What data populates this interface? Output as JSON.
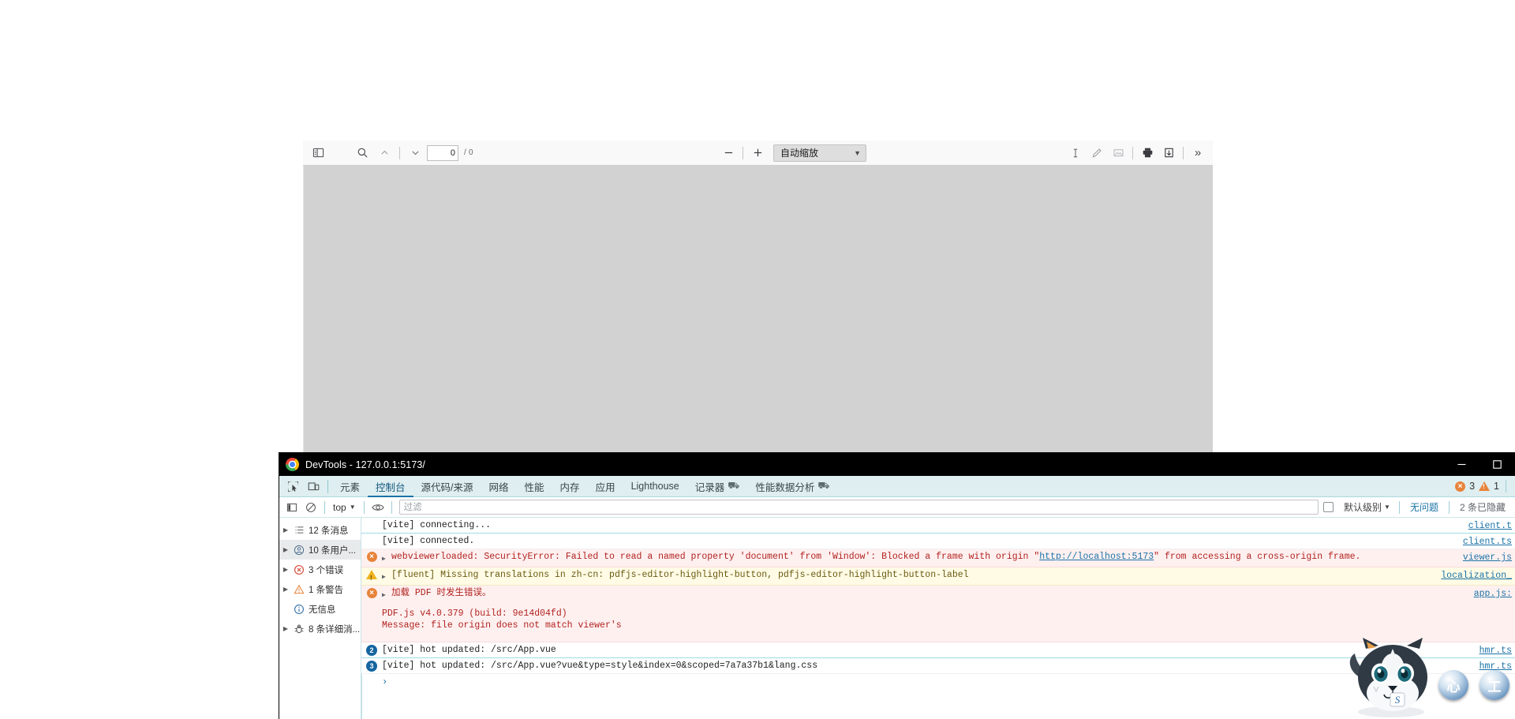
{
  "pdf_viewer": {
    "sidebar_toggle": "sidebar-toggle",
    "find_label": "find",
    "page_value": "0",
    "page_total": "/ 0",
    "zoom_out": "−",
    "zoom_in": "+",
    "zoom_level": "自动缩放",
    "tools": [
      "text-select-tool",
      "draw-tool",
      "image-tool",
      "print-tool",
      "save-tool",
      "more-tools"
    ],
    "more_label": "»"
  },
  "devtools": {
    "window_title": "DevTools - 127.0.0.1:5173/",
    "window_controls": {
      "minimize": "—",
      "maximize": "☐"
    },
    "tabs": [
      {
        "label": "元素",
        "active": false,
        "flask": false
      },
      {
        "label": "控制台",
        "active": true,
        "flask": false
      },
      {
        "label": "源代码/来源",
        "active": false,
        "flask": false
      },
      {
        "label": "网络",
        "active": false,
        "flask": false
      },
      {
        "label": "性能",
        "active": false,
        "flask": false
      },
      {
        "label": "内存",
        "active": false,
        "flask": false
      },
      {
        "label": "应用",
        "active": false,
        "flask": false
      },
      {
        "label": "Lighthouse",
        "active": false,
        "flask": false
      },
      {
        "label": "记录器",
        "active": false,
        "flask": true
      },
      {
        "label": "性能数据分析",
        "active": false,
        "flask": true
      }
    ],
    "status": {
      "error_count": "3",
      "warning_count": "1"
    },
    "filterbar": {
      "context": "top",
      "filter_placeholder": "过滤",
      "level": "默认级别",
      "issues": "无问题",
      "hidden": "2 条已隐藏"
    },
    "sidebar": [
      {
        "label": "12 条消息",
        "icon": "list-icon",
        "arrow": true,
        "selected": false
      },
      {
        "label": "10 条用户...",
        "icon": "user-icon",
        "arrow": true,
        "selected": true
      },
      {
        "label": "3 个错误",
        "icon": "error-icon",
        "arrow": true,
        "selected": false
      },
      {
        "label": "1 条警告",
        "icon": "warning-icon",
        "arrow": true,
        "selected": false
      },
      {
        "label": "无信息",
        "icon": "info-icon",
        "arrow": false,
        "selected": false
      },
      {
        "label": "8 条详细消...",
        "icon": "bug-icon",
        "arrow": true,
        "selected": false
      }
    ],
    "logs": [
      {
        "kind": "plain",
        "icon": "none",
        "expandable": false,
        "text": "[vite] connecting...",
        "source": "client.t",
        "separator": "info"
      },
      {
        "kind": "plain",
        "icon": "none",
        "expandable": false,
        "text": "[vite] connected.",
        "source": "client.ts"
      },
      {
        "kind": "err",
        "icon": "error",
        "expandable": true,
        "text_pre": "webviewerloaded: SecurityError: Failed to read a named property 'document' from 'Window': Blocked a frame with origin \"",
        "link": "http://localhost:5173",
        "text_post": "\" from accessing a cross-origin frame.",
        "source": "viewer.js"
      },
      {
        "kind": "warn",
        "icon": "warn",
        "expandable": true,
        "text": "[fluent] Missing translations in zh-cn: pdfjs-editor-highlight-button, pdfjs-editor-highlight-button-label",
        "source": "localization_"
      },
      {
        "kind": "err",
        "icon": "error",
        "expandable": true,
        "text": "加载 PDF 时发生错误。",
        "source": "app.js:"
      },
      {
        "kind": "err",
        "icon": "none",
        "expandable": false,
        "text": "PDF.js v4.0.379 (build: 9e14d04fd)\nMessage: file origin does not match viewer's",
        "source": ""
      },
      {
        "kind": "plain",
        "icon": "count",
        "count": "2",
        "expandable": false,
        "text": "[vite] hot updated: /src/App.vue",
        "source": "hmr.ts",
        "separator": "info"
      },
      {
        "kind": "plain",
        "icon": "count",
        "count": "3",
        "expandable": false,
        "text": "[vite] hot updated: /src/App.vue?vue&type=style&index=0&scoped=7a7a37b1&lang.css",
        "source": "hmr.ts"
      }
    ],
    "prompt": "›"
  },
  "ime": {
    "mascot": "husky-mascot",
    "buttons": [
      {
        "name": "ime-skin-button",
        "glyph": "心"
      },
      {
        "name": "ime-toolbox-button",
        "glyph": "工"
      }
    ]
  },
  "colors": {
    "accent": "#1a73a7",
    "error": "#e8833a",
    "warning": "#efb21f",
    "devtools_tabbar": "#dfeef0",
    "pdf_bg": "#d2d2d2"
  }
}
